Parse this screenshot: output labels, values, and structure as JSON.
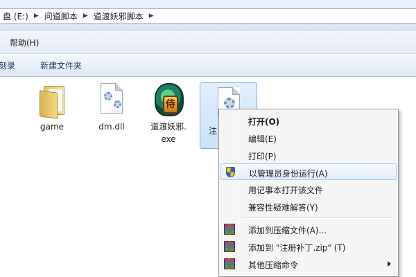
{
  "breadcrumb": {
    "items": [
      "盘 (E:)",
      "问道脚本",
      "道渡妖邪脚本"
    ]
  },
  "menubar": {
    "help_label": "帮助(H)"
  },
  "commandbar": {
    "burn_label": "刻录",
    "new_folder_label": "新建文件夹"
  },
  "files": [
    {
      "name": "game",
      "icon": "folder-icon"
    },
    {
      "name": "dm.dll",
      "icon": "dll-file-icon"
    },
    {
      "name_line1": "道渡妖邪.",
      "name_line2": "exe",
      "icon": "dragon-app-icon"
    },
    {
      "name": "注",
      "icon": "reg-file-icon",
      "selected": true
    }
  ],
  "context_menu": {
    "items": [
      {
        "label": "打开(O)",
        "bold": true
      },
      {
        "label": "编辑(E)"
      },
      {
        "label": "打印(P)"
      },
      {
        "label": "以管理员身份运行(A)",
        "icon": "uac-shield-icon",
        "highlighted": true
      },
      {
        "label": "用记事本打开该文件"
      },
      {
        "label": "兼容性疑难解答(Y)"
      },
      {
        "label": "添加到压缩文件(A)...",
        "icon": "winrar-icon"
      },
      {
        "label": "添加到 \"注册补丁.zip\" (T)",
        "icon": "winrar-icon"
      },
      {
        "label": "其他压缩命令",
        "icon": "winrar-icon",
        "has_submenu": true
      }
    ]
  },
  "colors": {
    "selection_fill": "#cde2f8",
    "selection_border": "#84aee0",
    "menu_highlight_border": "#a8c7ef"
  }
}
